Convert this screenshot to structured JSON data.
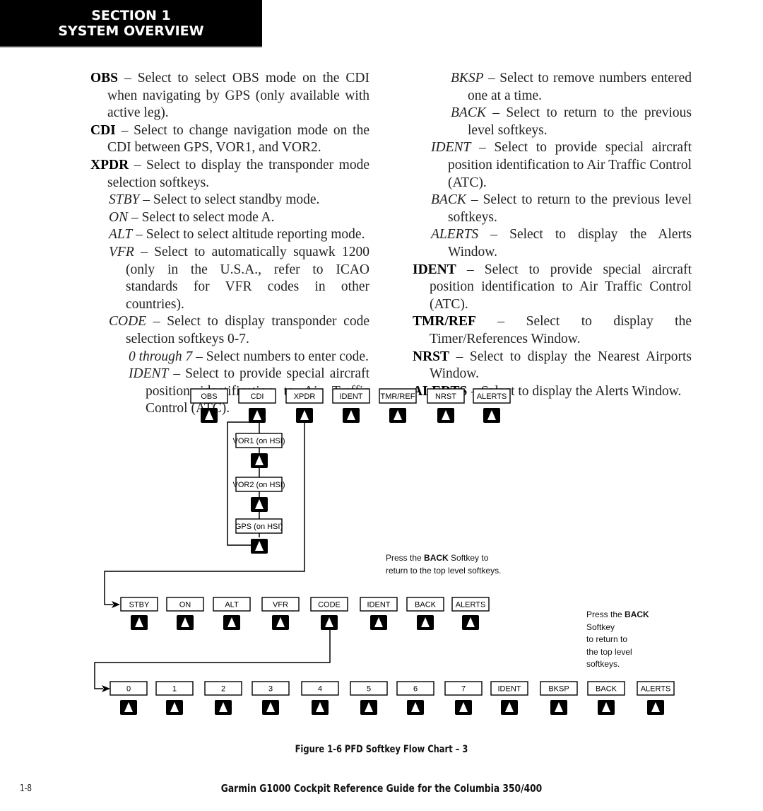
{
  "header": {
    "section_line1": "SECTION 1",
    "section_line2": "SYSTEM OVERVIEW"
  },
  "left_column": [
    {
      "term": "OBS",
      "style": "bold",
      "level": 1,
      "text": " – Select to select OBS mode on the CDI when navigating by GPS (only available with active leg)."
    },
    {
      "term": "CDI",
      "style": "bold",
      "level": 1,
      "text": " – Select to change navigation mode on the CDI between GPS, VOR1, and VOR2."
    },
    {
      "term": "XPDR",
      "style": "bold",
      "level": 1,
      "text": " – Select to display the transponder mode selection softkeys."
    },
    {
      "term": "STBY",
      "style": "italic",
      "level": 2,
      "text": " – Select to select standby mode."
    },
    {
      "term": "ON",
      "style": "italic",
      "level": 2,
      "text": " – Select to select mode A."
    },
    {
      "term": "ALT",
      "style": "italic",
      "level": 2,
      "text": " – Select to select altitude reporting mode."
    },
    {
      "term": "VFR",
      "style": "italic",
      "level": 2,
      "text": " – Select to automatically squawk 1200 (only in the U.S.A., refer to ICAO standards for VFR codes in other countries)."
    },
    {
      "term": "CODE",
      "style": "italic",
      "level": 2,
      "text": " – Select to display transponder code selection softkeys 0-7."
    },
    {
      "term": "0 through 7",
      "style": "italic",
      "level": 3,
      "text": " – Select numbers to enter code."
    },
    {
      "term": "IDENT",
      "style": "italic",
      "level": 3,
      "text": " – Select to provide special aircraft position identification to Air Traffic Control (ATC)."
    }
  ],
  "right_column": [
    {
      "term": "BKSP",
      "style": "italic",
      "level": 3,
      "text": " – Select to remove numbers entered one at a time."
    },
    {
      "term": "BACK",
      "style": "italic",
      "level": 3,
      "text": " – Select to return to the previous level softkeys."
    },
    {
      "term": "IDENT",
      "style": "italic",
      "level": 2,
      "text": " – Select to provide special aircraft position identification to Air Traffic Control (ATC)."
    },
    {
      "term": "BACK",
      "style": "italic",
      "level": 2,
      "text": " – Select to return to the previous level softkeys."
    },
    {
      "term": "ALERTS",
      "style": "italic",
      "level": 2,
      "text": " – Select to display the Alerts Window."
    },
    {
      "term": "IDENT",
      "style": "bold",
      "level": 1,
      "text": " – Select to provide special aircraft position identification to Air Traffic Control (ATC)."
    },
    {
      "term": "TMR/REF",
      "style": "bold",
      "level": 1,
      "text": " – Select to display the Timer/References Window."
    },
    {
      "term": "NRST",
      "style": "bold",
      "level": 1,
      "text": " – Select to display the Nearest Airports Window."
    },
    {
      "term": "ALERTS",
      "style": "bold",
      "level": 1,
      "text": " – Select to display the Alerts Window."
    }
  ],
  "diagram": {
    "top_row": [
      "OBS",
      "CDI",
      "XPDR",
      "IDENT",
      "TMR/REF",
      "NRST",
      "ALERTS"
    ],
    "cdi_chain": [
      "VOR1 (on HSI)",
      "VOR2 (on HSI)",
      "GPS (on HSI)"
    ],
    "xpdr_row": [
      "STBY",
      "ON",
      "ALT",
      "VFR",
      "CODE",
      "IDENT",
      "BACK",
      "ALERTS"
    ],
    "code_row": [
      "0",
      "1",
      "2",
      "3",
      "4",
      "5",
      "6",
      "7",
      "IDENT",
      "BKSP",
      "BACK",
      "ALERTS"
    ],
    "note_xpdr": {
      "prefix": "Press the ",
      "bold": "BACK",
      "suffix": " Softkey to return to the top level softkeys."
    },
    "note_code": {
      "prefix": "Press the ",
      "bold": "BACK",
      "line2": "Softkey",
      "line3": "to return to",
      "line4": "the top level",
      "line5": "softkeys."
    },
    "icons": {
      "softkey_button": "up-arrow-softkey-icon"
    }
  },
  "figure_caption": "Figure 1-6  PFD Softkey Flow Chart – 3",
  "footer": {
    "page_number": "1-8",
    "title": "Garmin G1000 Cockpit Reference Guide for the Columbia 350/400"
  }
}
